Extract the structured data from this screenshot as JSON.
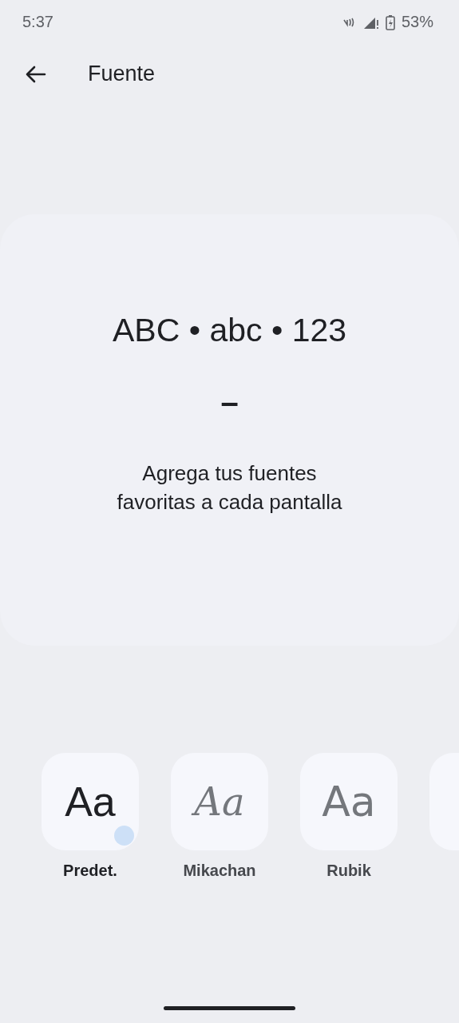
{
  "status_bar": {
    "time": "5:37",
    "battery": "53%"
  },
  "header": {
    "title": "Fuente"
  },
  "preview": {
    "sample": "ABC • abc • 123",
    "divider": "–",
    "caption": "Agrega tus fuentes favoritas a cada pantalla"
  },
  "fonts": [
    {
      "kind": "sans",
      "preview": "Aa",
      "label": "Predet.",
      "selected": true
    },
    {
      "kind": "handwritten",
      "preview": "Aa",
      "label": "Mikachan",
      "selected": false
    },
    {
      "kind": "rounded",
      "preview": "Aa",
      "label": "Rubik",
      "selected": false
    },
    {
      "kind": "cut"
    }
  ]
}
